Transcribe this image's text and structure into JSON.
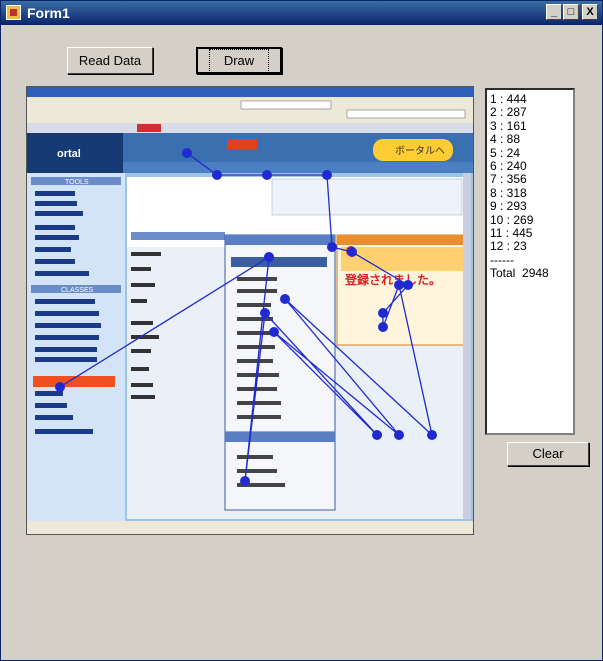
{
  "window": {
    "title": "Form1",
    "minimize": "_",
    "maximize": "□",
    "close": "X"
  },
  "buttons": {
    "read_data": "Read Data",
    "draw": "Draw",
    "clear": "Clear"
  },
  "list": {
    "items": [
      "1 : 444",
      "2 : 287",
      "3 : 161",
      "4 : 88",
      "5 : 24",
      "6 : 240",
      "7 : 356",
      "8 : 318",
      "9 : 293",
      "10 : 269",
      "11 : 445",
      "12 : 23"
    ],
    "separator": "------",
    "total": "Total  2948"
  },
  "screenshot": {
    "brand": "ortal",
    "tab": "ボータルへ",
    "section1": "TOOLS",
    "section2": "CLASSES",
    "toast": "登録されました。"
  },
  "colors": {
    "accent": "#1f2ad0",
    "titlebar": "#0a246a",
    "face": "#d4d0c8"
  }
}
